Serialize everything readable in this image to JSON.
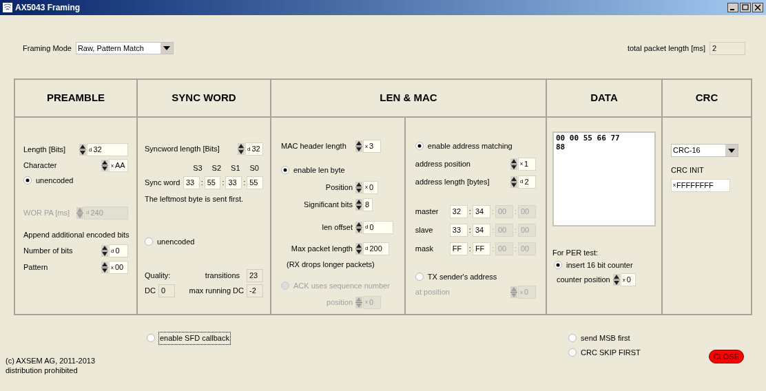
{
  "window": {
    "title": "AX5043 Framing"
  },
  "framing_mode": {
    "label": "Framing Mode",
    "value": "Raw, Pattern Match"
  },
  "total_packet_length": {
    "label": "total packet length [ms]",
    "value": "2"
  },
  "sections": [
    {
      "title": "PREAMBLE"
    },
    {
      "title": "SYNC WORD"
    },
    {
      "title": "LEN & MAC"
    },
    {
      "title": "DATA"
    },
    {
      "title": "CRC"
    }
  ],
  "preamble": {
    "length": {
      "label": "Length [Bits]",
      "radix": "d",
      "value": "32",
      "disabled": false
    },
    "character": {
      "label": "Character",
      "radix": "x",
      "value": "AA",
      "disabled": false
    },
    "unencoded": {
      "label": "unencoded",
      "checked": true,
      "disabled": false
    },
    "wor_pa": {
      "label": "WOR PA [ms]",
      "radix": "d",
      "value": "240",
      "disabled": true
    },
    "append_heading": "Append additional encoded bits",
    "number_of_bits": {
      "label": "Number of bits",
      "radix": "d",
      "value": "0",
      "disabled": false
    },
    "pattern": {
      "label": "Pattern",
      "radix": "x",
      "value": "00",
      "disabled": false
    }
  },
  "sync_word": {
    "length": {
      "label": "Syncword length [Bits]",
      "radix": "d",
      "value": "32",
      "disabled": false
    },
    "byte_labels": [
      "S3",
      "S2",
      "S1",
      "S0"
    ],
    "label": "Sync word",
    "bytes": [
      "33",
      "55",
      "33",
      "55"
    ],
    "separator": ":",
    "note": "The leftmost byte is sent first.",
    "unencoded": {
      "label": "unencoded",
      "checked": false,
      "disabled": false
    },
    "quality_label": "Quality:",
    "transitions": {
      "label": "transitions",
      "value": "23"
    },
    "dc": {
      "label": "DC",
      "value": "0"
    },
    "max_running_dc": {
      "label": "max running DC",
      "value": "-2"
    }
  },
  "len_mac": {
    "mac_header_length": {
      "label": "MAC header length",
      "radix": "x",
      "value": "3",
      "disabled": false
    },
    "enable_len_byte": {
      "label": "enable len byte",
      "checked": true,
      "disabled": false
    },
    "position": {
      "label": "Position",
      "radix": "x",
      "value": "0",
      "disabled": false
    },
    "significant_bits": {
      "label": "Significant bits",
      "value": "8",
      "disabled": false
    },
    "len_offset": {
      "label": "len offset",
      "radix": "d",
      "value": "0",
      "disabled": false
    },
    "max_packet_length": {
      "label": "Max packet length",
      "radix": "d",
      "value": "200",
      "disabled": false
    },
    "max_note": "(RX drops longer packets)",
    "ack": {
      "label": "ACK uses sequence number",
      "checked": false,
      "disabled": true
    },
    "ack_position": {
      "label": "position",
      "radix": "x",
      "value": "0",
      "disabled": true
    },
    "address_matching": {
      "label": "enable address matching",
      "checked": true,
      "disabled": false
    },
    "address_position": {
      "label": "address position",
      "radix": "x",
      "value": "1",
      "disabled": false
    },
    "address_length": {
      "label": "address length [bytes]",
      "radix": "d",
      "value": "2",
      "disabled": false
    },
    "addresses": [
      {
        "label": "master",
        "bytes": [
          {
            "value": "32",
            "disabled": false
          },
          {
            "value": "34",
            "disabled": false
          },
          {
            "value": "00",
            "disabled": true
          },
          {
            "value": "00",
            "disabled": true
          }
        ]
      },
      {
        "label": "slave",
        "bytes": [
          {
            "value": "33",
            "disabled": false
          },
          {
            "value": "34",
            "disabled": false
          },
          {
            "value": "00",
            "disabled": true
          },
          {
            "value": "00",
            "disabled": true
          }
        ]
      },
      {
        "label": "mask",
        "bytes": [
          {
            "value": "FF",
            "disabled": false
          },
          {
            "value": "FF",
            "disabled": false
          },
          {
            "value": "00",
            "disabled": true
          },
          {
            "value": "00",
            "disabled": true
          }
        ]
      }
    ],
    "separator": ":",
    "tx_sender": {
      "label": "TX sender's address",
      "checked": false,
      "disabled": false
    },
    "at_position": {
      "label": "at position",
      "radix": "x",
      "value": "0",
      "disabled": true
    }
  },
  "data": {
    "payload": [
      "00 00 55 66 77",
      "88"
    ],
    "per_label": "For PER test:",
    "insert_counter": {
      "label": "insert 16 bit counter",
      "checked": true,
      "disabled": false
    },
    "counter_position": {
      "label": "counter position",
      "radix": "x",
      "value": "0",
      "disabled": false
    }
  },
  "crc": {
    "type": "CRC-16",
    "init_label": "CRC INIT",
    "init": {
      "radix": "x",
      "value": "FFFFFFFF"
    }
  },
  "sfd_callback": {
    "label": "enable SFD callback",
    "checked": false,
    "disabled": false,
    "focused": true
  },
  "send_msb_first": {
    "label": "send MSB first",
    "checked": false,
    "disabled": false,
    "focused": false
  },
  "crc_skip_first": {
    "label": "CRC SKIP FIRST",
    "checked": false,
    "disabled": false,
    "focused": false
  },
  "footer": [
    "(c) AXSEM AG, 2011-2013",
    "distribution prohibited"
  ],
  "close_button": "CLOSE"
}
